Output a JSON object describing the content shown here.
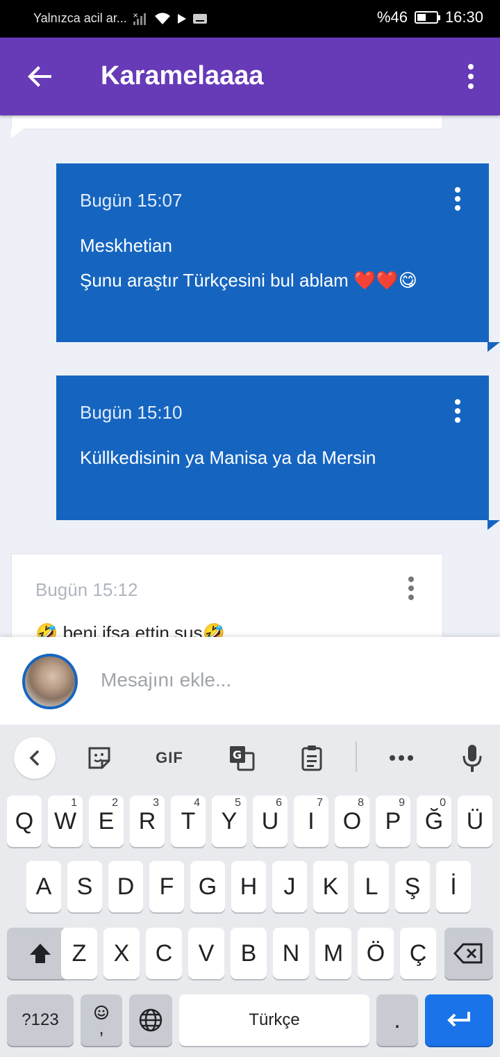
{
  "status_bar": {
    "carrier": "Yalnızca acil ar...",
    "battery": "%46",
    "time": "16:30"
  },
  "app_bar": {
    "title": "Karamelaaaa"
  },
  "messages": [
    {
      "time": "Bugün 15:07",
      "lines": [
        "Meskhetian",
        "Şunu araştır Türkçesini bul ablam ❤️❤️😋"
      ]
    },
    {
      "time": "Bugün 15:10",
      "lines": [
        "Küllkedisinin ya Manisa ya da Mersin"
      ]
    },
    {
      "time": "Bugün 15:12",
      "lines": [
        "🤣 beni ifşa ettin sus🤣"
      ]
    }
  ],
  "compose": {
    "placeholder": "Mesajını ekle..."
  },
  "keyboard": {
    "toolbar": {
      "gif": "GIF"
    },
    "row1": [
      "Q",
      "W",
      "E",
      "R",
      "T",
      "Y",
      "U",
      "I",
      "O",
      "P",
      "Ğ",
      "Ü"
    ],
    "row1_hints": [
      "",
      "1",
      "2",
      "3",
      "4",
      "5",
      "6",
      "7",
      "8",
      "9",
      "0",
      ""
    ],
    "row2": [
      "A",
      "S",
      "D",
      "F",
      "G",
      "H",
      "J",
      "K",
      "L",
      "Ş",
      "İ"
    ],
    "row3": [
      "Z",
      "X",
      "C",
      "V",
      "B",
      "N",
      "M",
      "Ö",
      "Ç"
    ],
    "symbols_key": "?123",
    "comma_key": ",",
    "space_label": "Türkçe",
    "period_key": "."
  }
}
